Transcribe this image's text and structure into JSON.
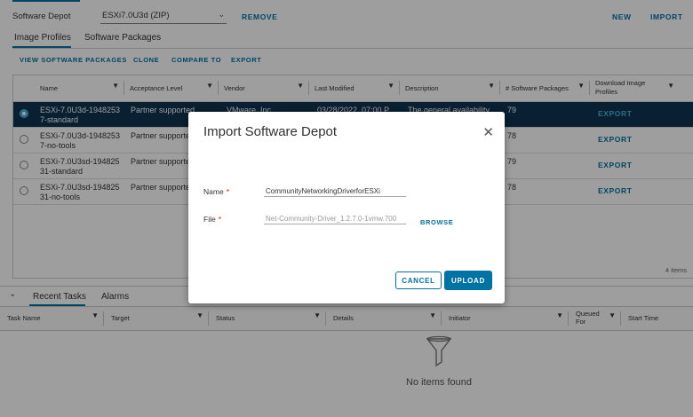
{
  "top": {
    "depot_label": "Software Depot",
    "depot_value": "ESXi7.0U3d (ZIP)",
    "remove": "REMOVE",
    "new": "NEW",
    "import": "IMPORT"
  },
  "tabs": [
    "Image Profiles",
    "Software Packages"
  ],
  "actions": [
    "VIEW SOFTWARE PACKAGES",
    "CLONE",
    "COMPARE TO",
    "EXPORT"
  ],
  "columns": [
    "Name",
    "Acceptance Level",
    "Vendor",
    "Last Modified",
    "Description",
    "# Software Packages",
    "Download Image Profiles"
  ],
  "rows": [
    {
      "name1": "ESXi-7.0U3d-1948253",
      "name2": "7-standard",
      "acceptance": "Partner supported",
      "vendor": "VMware, Inc.",
      "modified": "03/28/2022, 07:00 P",
      "description": "The general availability",
      "packages": "79",
      "download": "EXPORT",
      "selected": true
    },
    {
      "name1": "ESXi-7.0U3d-1948253",
      "name2": "7-no-tools",
      "acceptance": "Partner supporte",
      "vendor": "",
      "modified": "",
      "description": "",
      "packages": "78",
      "download": "EXPORT",
      "selected": false
    },
    {
      "name1": "ESXi-7.0U3sd-194825",
      "name2": "31-standard",
      "acceptance": "Partner supporte",
      "vendor": "",
      "modified": "",
      "description": "",
      "packages": "79",
      "download": "EXPORT",
      "selected": false
    },
    {
      "name1": "ESXi-7.0U3sd-194825",
      "name2": "31-no-tools",
      "acceptance": "Partner supporte",
      "vendor": "",
      "modified": "",
      "description": "",
      "packages": "78",
      "download": "EXPORT",
      "selected": false
    }
  ],
  "item_count": "4 items",
  "bottom": {
    "tabs": [
      "Recent Tasks",
      "Alarms"
    ],
    "columns": [
      "Task Name",
      "Target",
      "Status",
      "Details",
      "Initiator",
      "Queued For",
      "Start Time"
    ],
    "empty": "No items found"
  },
  "modal": {
    "title": "Import Software Depot",
    "name_label": "Name",
    "name_value": "CommunityNetworkingDriverforESXi",
    "file_label": "File",
    "file_value": "Net-Community-Driver_1.2.7.0-1vmw.700",
    "required": "*",
    "browse": "BROWSE",
    "cancel": "CANCEL",
    "upload": "UPLOAD"
  },
  "colors": {
    "accent": "#0072a3",
    "selected_row": "#0d3552",
    "overlay": "rgba(0,0,0,0.38)"
  }
}
